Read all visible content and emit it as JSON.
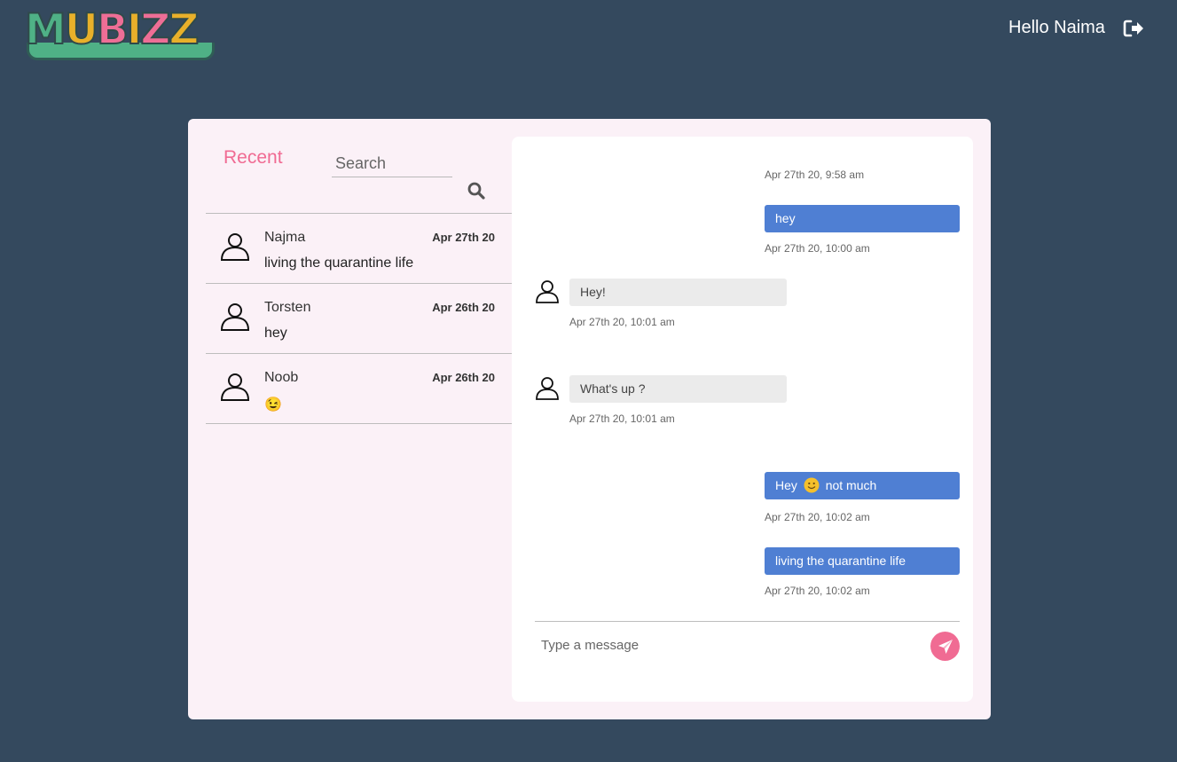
{
  "header": {
    "logo_text": "MUBIZZ",
    "greeting": "Hello Naima",
    "logout_icon": "sign-out-icon"
  },
  "sidebar": {
    "title": "Recent",
    "search_placeholder": "Search",
    "search_icon": "search-icon",
    "conversations": [
      {
        "name": "Najma",
        "date": "Apr 27th 20",
        "preview": "living the quarantine life"
      },
      {
        "name": "Torsten",
        "date": "Apr 26th 20",
        "preview": "hey"
      },
      {
        "name": "Noob",
        "date": "Apr 26th 20",
        "preview": "😉"
      }
    ]
  },
  "chat": {
    "top_timestamp": "Apr 27th 20, 9:58 am",
    "messages": [
      {
        "direction": "out",
        "text": "hey",
        "time": "Apr 27th 20, 10:00 am"
      },
      {
        "direction": "in",
        "text": "Hey!",
        "time": "Apr 27th 20, 10:01 am"
      },
      {
        "direction": "in",
        "text": "What's up ?",
        "time": "Apr 27th 20, 10:01 am"
      },
      {
        "direction": "out",
        "text_before": "Hey",
        "emoji": "smiley-emoji",
        "text_after": "not much",
        "time": "Apr 27th 20, 10:02 am"
      },
      {
        "direction": "out",
        "text": "living the quarantine life",
        "time": "Apr 27th 20, 10:02 am"
      }
    ],
    "composer_placeholder": "Type a message",
    "send_icon": "paper-plane-icon"
  },
  "colors": {
    "background": "#34495e",
    "panel": "#fbf1f7",
    "accent_pink": "#f06b93",
    "outgoing_bubble": "#4f7fd3",
    "incoming_bubble": "#ebebeb"
  }
}
